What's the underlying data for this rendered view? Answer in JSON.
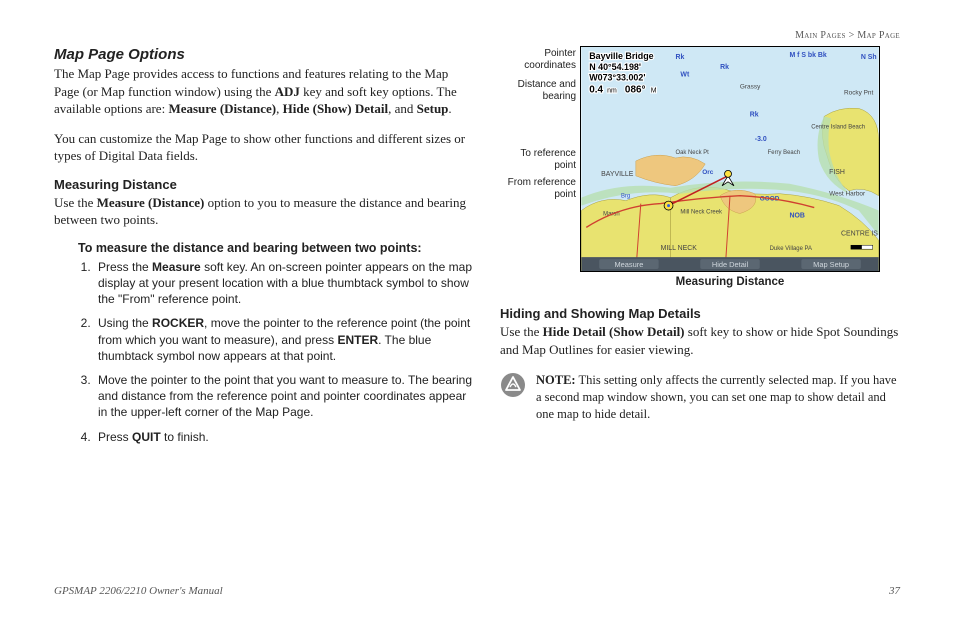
{
  "breadcrumb": {
    "left": "Main Pages",
    "sep": " > ",
    "right": "Map Page"
  },
  "title": "Map Page Options",
  "intro1_a": "The Map Page provides access to functions and features relating to the Map Page (or Map function window) using the ",
  "intro1_adj": "ADJ",
  "intro1_b": " key and soft key options. The available options are: ",
  "intro1_opt1": "Measure (Distance)",
  "intro1_c": ", ",
  "intro1_opt2": "Hide (Show) Detail",
  "intro1_d": ", and ",
  "intro1_opt3": "Setup",
  "intro1_e": ".",
  "intro2": "You can customize the Map Page to show other functions and different sizes or types of Digital Data fields.",
  "measuring_heading": "Measuring Distance",
  "measuring_body_a": "Use the ",
  "measuring_body_b": "Measure (Distance)",
  "measuring_body_c": " option to you to measure the distance and bearing between two points.",
  "procedure_heading": "To measure the distance and bearing between two points:",
  "steps": {
    "s1_a": "Press the ",
    "s1_b": "Measure",
    "s1_c": " soft key. An on-screen pointer appears on the map display at your present location with a blue thumbtack symbol to show the \"From\" reference point.",
    "s2_a": "Using the ",
    "s2_b": "ROCKER",
    "s2_c": ", move the pointer to the reference point (the point from which you want to measure), and press ",
    "s2_d": "ENTER",
    "s2_e": ". The blue thumbtack symbol now appears at that point.",
    "s3": "Move the pointer to the point that you want to measure to. The bearing and distance from the reference point and pointer coordinates appear in the upper-left corner of the Map Page.",
    "s4_a": "Press ",
    "s4_b": "QUIT",
    "s4_c": " to finish."
  },
  "figure": {
    "labels": {
      "pointer": "Pointer coordinates",
      "distbear": "Distance and bearing",
      "toref": "To reference point",
      "fromref": "From reference point"
    },
    "overlay": {
      "title": "Bayville Bridge",
      "lat": "N  40°54.198'",
      "lon": "W073°33.002'",
      "dist": "0.4",
      "unit": "nm",
      "brg": "086°",
      "m": "M"
    },
    "softkeys": {
      "k1": "Measure",
      "k2": "Hide Detail",
      "k3": "Map Setup"
    },
    "map_text": {
      "rk1": "Rk",
      "wt1": "Wt",
      "rk2": "Rk",
      "rk3": "Rk",
      "mfskbk": "M f S bk Bk",
      "nsh": "N Sh",
      "rocky": "Rocky Pnt",
      "grassy": "Grassy",
      "centre_beach": "Centre Island Beach",
      "centre_is": "CENTRE IS",
      "bayville": "BAYVILLE",
      "west": "West Harbor",
      "oak": "Oak Neck Pt",
      "ferry": "Ferry Beach",
      "orc": "Orc",
      "marsh": "Marsh",
      "mill_creek": "Mill Neck Creek",
      "fish": "FISH",
      "nob": "NOB",
      "good": "GOOD",
      "min30": "-3.0",
      "mill_neck": "MILL NECK",
      "duke": "Duke Village PA",
      "brg_lbl": "Brg"
    },
    "caption": "Measuring Distance"
  },
  "hiding_heading": "Hiding and Showing Map Details",
  "hiding_body_a": "Use the ",
  "hiding_body_b": "Hide Detail (Show Detail)",
  "hiding_body_c": " soft key to show or hide Spot Soundings and Map Outlines for easier viewing.",
  "note_label": "NOTE:",
  "note_body": " This setting only affects the currently selected map. If you have a second map window shown, you can set one map to show detail and one map to hide detail.",
  "footer": {
    "left": "GPSMAP 2206/2210 Owner's Manual",
    "right": "37"
  }
}
